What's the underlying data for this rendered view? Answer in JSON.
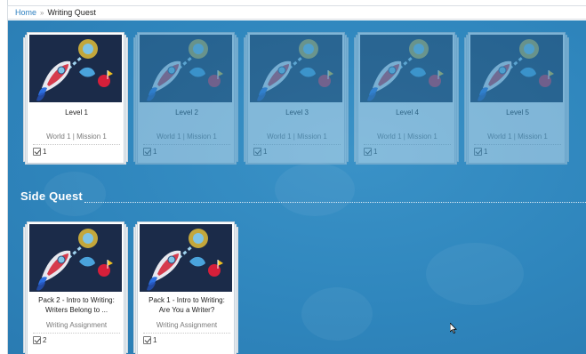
{
  "breadcrumb": {
    "home": "Home",
    "separator": "»",
    "current": "Writing Quest"
  },
  "levels": [
    {
      "title": "Level 1",
      "subtitle": "World 1 | Mission 1",
      "count": "1",
      "locked": false
    },
    {
      "title": "Level 2",
      "subtitle": "World 1 | Mission 1",
      "count": "1",
      "locked": true
    },
    {
      "title": "Level 3",
      "subtitle": "World 1 | Mission 1",
      "count": "1",
      "locked": true
    },
    {
      "title": "Level 4",
      "subtitle": "World 1 | Mission 1",
      "count": "1",
      "locked": true
    },
    {
      "title": "Level 5",
      "subtitle": "World 1 | Mission 1",
      "count": "1",
      "locked": true
    }
  ],
  "side_quest": {
    "heading": "Side Quest",
    "items": [
      {
        "title_line1": "Pack 2 - Intro to Writing:",
        "title_line2": "Writers Belong to ...",
        "subtitle": "Writing Assignment",
        "count": "2"
      },
      {
        "title_line1": "Pack 1 - Intro to Writing:",
        "title_line2": "Are You a Writer?",
        "subtitle": "Writing Assignment",
        "count": "1"
      }
    ]
  },
  "colors": {
    "background": "#2f86bd",
    "link": "#2c7fc0",
    "thumbnail_bg": "#1a2a47"
  },
  "icons": {
    "thumbnail": "rocket-icon",
    "checkbox": "checkbox-checked-icon",
    "cursor": "pointer-cursor-icon"
  }
}
